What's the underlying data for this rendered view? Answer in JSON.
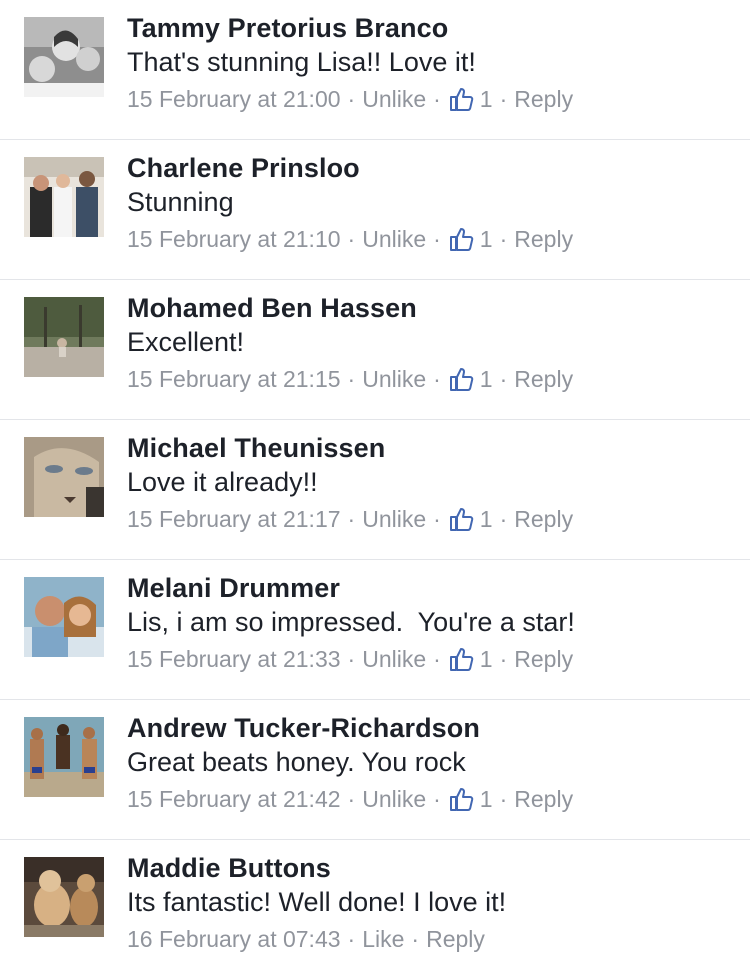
{
  "colors": {
    "name": "#1d2129",
    "meta": "#90949c",
    "thumb": "#4267b2",
    "divider": "#e3e5e9"
  },
  "icons": {
    "reaction": "thumbs-up-icon",
    "avatar": "profile-photo"
  },
  "comments": [
    {
      "author": "Tammy Pretorius Branco",
      "text": "That's stunning Lisa!! Love it!",
      "timestamp": "15 February at 21:00",
      "like_action": "Unlike",
      "like_count": "1",
      "reply_label": "Reply"
    },
    {
      "author": "Charlene Prinsloo",
      "text": "Stunning",
      "timestamp": "15 February at 21:10",
      "like_action": "Unlike",
      "like_count": "1",
      "reply_label": "Reply"
    },
    {
      "author": "Mohamed Ben Hassen",
      "text": "Excellent!",
      "timestamp": "15 February at 21:15",
      "like_action": "Unlike",
      "like_count": "1",
      "reply_label": "Reply"
    },
    {
      "author": "Michael Theunissen",
      "text": "Love it already!!",
      "timestamp": "15 February at 21:17",
      "like_action": "Unlike",
      "like_count": "1",
      "reply_label": "Reply"
    },
    {
      "author": "Melani Drummer",
      "text": "Lis, i am so impressed.  You're a star!",
      "timestamp": "15 February at 21:33",
      "like_action": "Unlike",
      "like_count": "1",
      "reply_label": "Reply"
    },
    {
      "author": "Andrew Tucker-Richardson",
      "text": "Great beats honey. You rock",
      "timestamp": "15 February at 21:42",
      "like_action": "Unlike",
      "like_count": "1",
      "reply_label": "Reply"
    },
    {
      "author": "Maddie Buttons",
      "text": "Its fantastic! Well done! I love it!",
      "timestamp": "16 February at 07:43",
      "like_action": "Like",
      "like_count": "",
      "reply_label": "Reply"
    }
  ]
}
